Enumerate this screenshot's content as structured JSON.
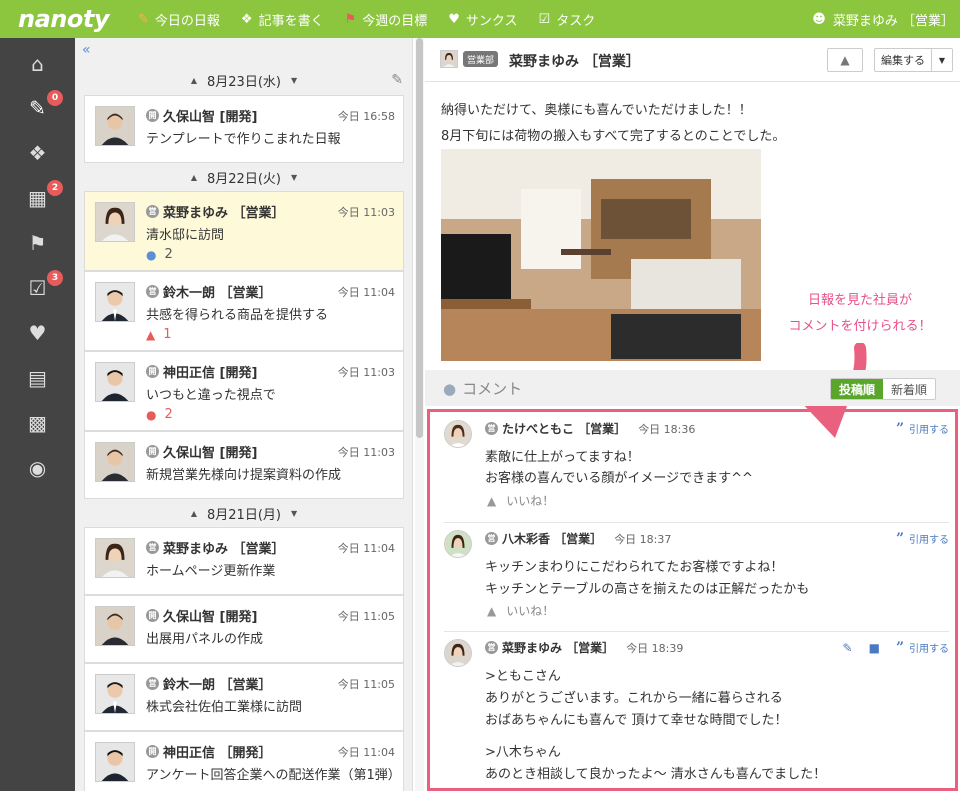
{
  "app": {
    "logo": "nanoty"
  },
  "topnav": [
    {
      "label": "今日の日報",
      "icon": "daily-report-icon",
      "color": "#f2a33a"
    },
    {
      "label": "記事を書く",
      "icon": "chat-icon",
      "color": "#ffffff"
    },
    {
      "label": "今週の目標",
      "icon": "flag-icon",
      "color": "#e85b5b"
    },
    {
      "label": "サンクス",
      "icon": "heart-icon",
      "color": "#ffffff"
    },
    {
      "label": "タスク",
      "icon": "task-icon",
      "color": "#ffffff"
    }
  ],
  "user": {
    "name": "菜野まゆみ ［営業］"
  },
  "sidebar": {
    "badges": {
      "report": "0",
      "calendar": "2",
      "task": "3"
    }
  },
  "list": {
    "groups": [
      {
        "date": "8月23日(水)"
      },
      {
        "date": "8月22日(火)"
      },
      {
        "date": "8月21日(月)"
      }
    ],
    "items": [
      {
        "name": "久保山智 [開発]",
        "time": "今日 16:58",
        "subject": "テンプレートで作りこまれた日報",
        "dept": "開"
      },
      {
        "name": "菜野まゆみ ［営業］",
        "time": "今日 11:03",
        "subject": "清水邸に訪問",
        "dept": "営",
        "reaction": "2",
        "reaction_type": "comment-blue"
      },
      {
        "name": "鈴木一朗 ［営業］",
        "time": "今日 11:04",
        "subject": "共感を得られる商品を提供する",
        "dept": "営",
        "reaction": "1",
        "reaction_type": "like-red"
      },
      {
        "name": "神田正信 [開発]",
        "time": "今日 11:03",
        "subject": "いつもと違った視点で",
        "dept": "開",
        "reaction": "2",
        "reaction_type": "comment-red"
      },
      {
        "name": "久保山智 [開発]",
        "time": "今日 11:03",
        "subject": "新規営業先様向け提案資料の作成",
        "dept": "開"
      },
      {
        "name": "菜野まゆみ ［営業］",
        "time": "今日 11:04",
        "subject": "ホームページ更新作業",
        "dept": "営"
      },
      {
        "name": "久保山智 [開発]",
        "time": "今日 11:05",
        "subject": "出展用パネルの作成",
        "dept": "開"
      },
      {
        "name": "鈴木一朗 ［営業］",
        "time": "今日 11:05",
        "subject": "株式会社佐伯工業様に訪問",
        "dept": "営"
      },
      {
        "name": "神田正信 ［開発］",
        "time": "今日 11:04",
        "subject": "アンケート回答企業への配送作業（第1弾）",
        "dept": "開"
      }
    ]
  },
  "detail": {
    "dept_tag": "営業部",
    "author": "菜野まゆみ ［営業］",
    "edit_label": "編集する",
    "body": [
      "納得いただけて、奥様にも喜んでいただけました！！",
      "8月下旬には荷物の搬入もすべて完了するとのことでした。"
    ],
    "callout": [
      "日報を見た社員が",
      "コメントを付けられる！"
    ]
  },
  "comments": {
    "title": "コメント",
    "sort": {
      "posted": "投稿順",
      "newest": "新着順"
    },
    "quote_label": "引用する",
    "like_label": "いいね！",
    "items": [
      {
        "name": "たけべともこ ［営業］",
        "time": "今日 18:36",
        "lines": [
          "素敵に仕上がってますね！",
          "お客様の喜んでいる顔がイメージできます^^"
        ]
      },
      {
        "name": "八木彩香 ［営業］",
        "time": "今日 18:37",
        "lines": [
          "キッチンまわりにこだわられてたお客様ですよね！",
          "キッチンとテーブルの高さを揃えたのは正解だったかも"
        ]
      },
      {
        "name": "菜野まゆみ ［営業］",
        "time": "今日 18:39",
        "lines": [
          ">ともこさん",
          "ありがとうございます。これから一緒に暮らされる",
          "おばあちゃんにも喜んで 頂けて幸せな時間でした！",
          ">八木ちゃん",
          "あのとき相談して良かったよ～ 清水さんも喜んでました！"
        ]
      }
    ]
  }
}
